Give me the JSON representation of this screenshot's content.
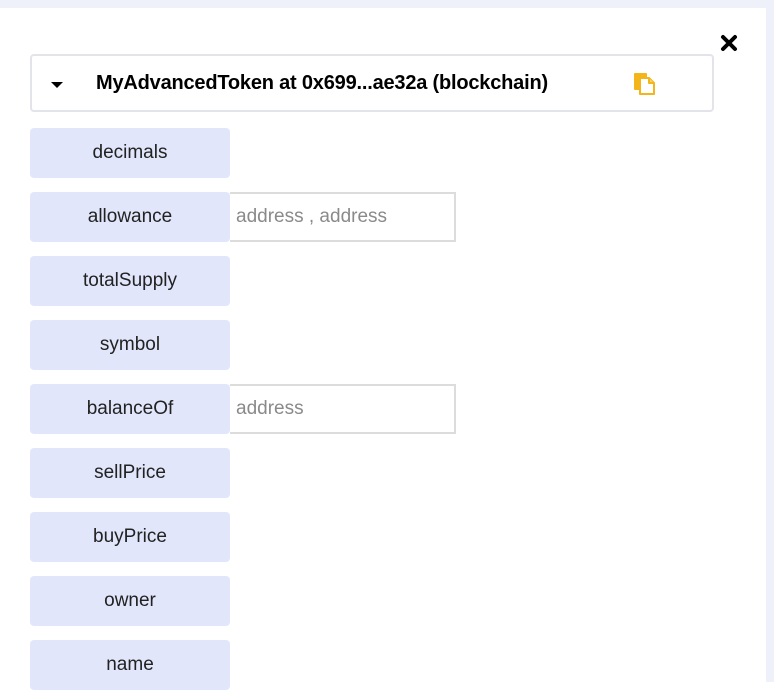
{
  "header": {
    "title": "MyAdvancedToken at 0x699...ae32a (blockchain)",
    "caret_icon": "caret-down-icon",
    "copy_icon": "copy-icon",
    "copy_icon_color": "#f3b51a"
  },
  "close_icon": "close-icon",
  "functions": [
    {
      "label": "decimals",
      "has_input": false,
      "placeholder": ""
    },
    {
      "label": "allowance",
      "has_input": true,
      "placeholder": "address , address"
    },
    {
      "label": "totalSupply",
      "has_input": false,
      "placeholder": ""
    },
    {
      "label": "symbol",
      "has_input": false,
      "placeholder": ""
    },
    {
      "label": "balanceOf",
      "has_input": true,
      "placeholder": "address"
    },
    {
      "label": "sellPrice",
      "has_input": false,
      "placeholder": ""
    },
    {
      "label": "buyPrice",
      "has_input": false,
      "placeholder": ""
    },
    {
      "label": "owner",
      "has_input": false,
      "placeholder": ""
    },
    {
      "label": "name",
      "has_input": false,
      "placeholder": ""
    }
  ],
  "colors": {
    "button_bg": "#e2e6fa",
    "accent": "#f3b51a"
  }
}
